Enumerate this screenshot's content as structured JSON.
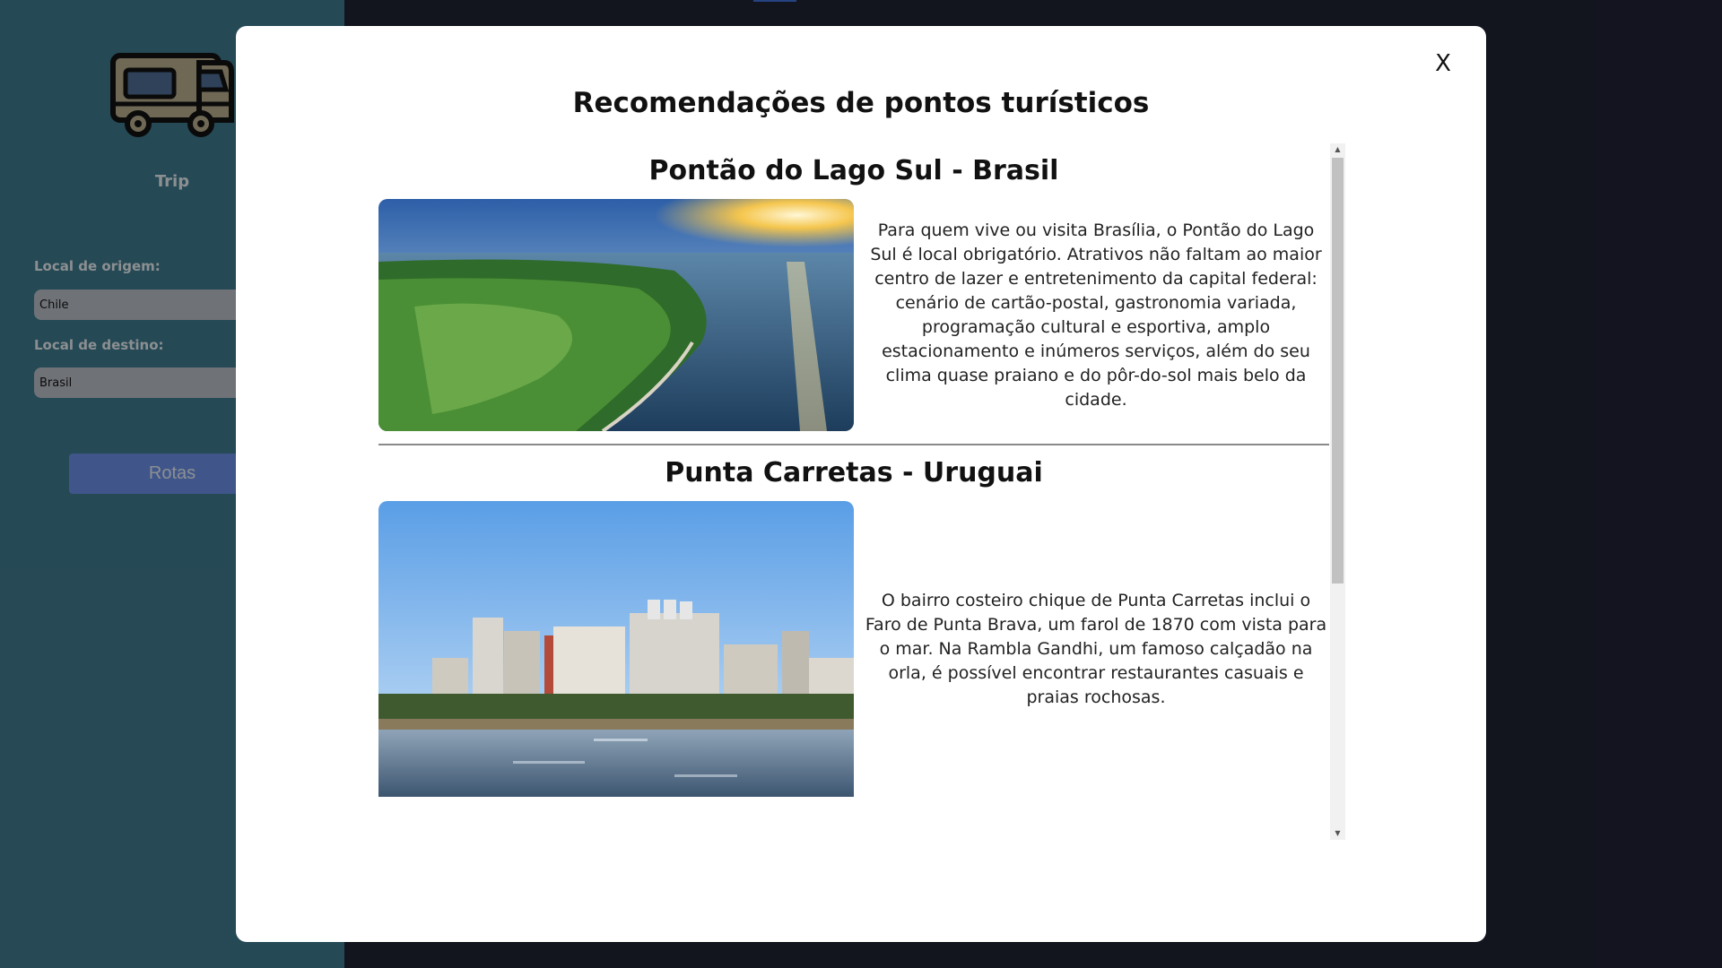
{
  "sidebar": {
    "brand": "Trip",
    "origin_label": "Local de origem:",
    "origin_value": "Chile",
    "destination_label": "Local de destino:",
    "destination_value": "Brasil",
    "routes_button": "Rotas"
  },
  "modal": {
    "close_label": "X",
    "title": "Recomendações de pontos turísticos",
    "places": [
      {
        "title": "Pontão do Lago Sul - Brasil",
        "description": "Para quem vive ou visita Brasília, o Pontão do Lago Sul é local obrigatório. Atrativos não faltam ao maior centro de lazer e entretenimento da capital federal: cenário de cartão-postal, gastronomia variada, programação cultural e esportiva, amplo estacionamento e inúmeros serviços, além do seu clima quase praiano e do pôr-do-sol mais belo da cidade."
      },
      {
        "title": "Punta Carretas - Uruguai",
        "description": "O bairro costeiro chique de Punta Carretas inclui o Faro de Punta Brava, um farol de 1870 com vista para o mar. Na Rambla Gandhi, um famoso calçadão na orla, é possível encontrar restaurantes casuais e praias rochosas."
      }
    ]
  },
  "colors": {
    "sidebar_bg": "#3f7a8e",
    "page_bg": "#1f2233",
    "button_bg": "#6c8fe6",
    "modal_bg": "#ffffff"
  },
  "icons": {
    "logo": "camper-van-icon"
  }
}
